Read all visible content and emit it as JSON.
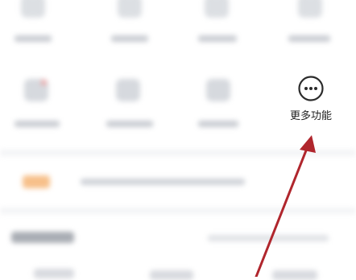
{
  "more_functions": {
    "label": "更多功能",
    "icon": "more-horizontal-icon"
  },
  "annotation": {
    "arrow_color": "#b0262d"
  }
}
